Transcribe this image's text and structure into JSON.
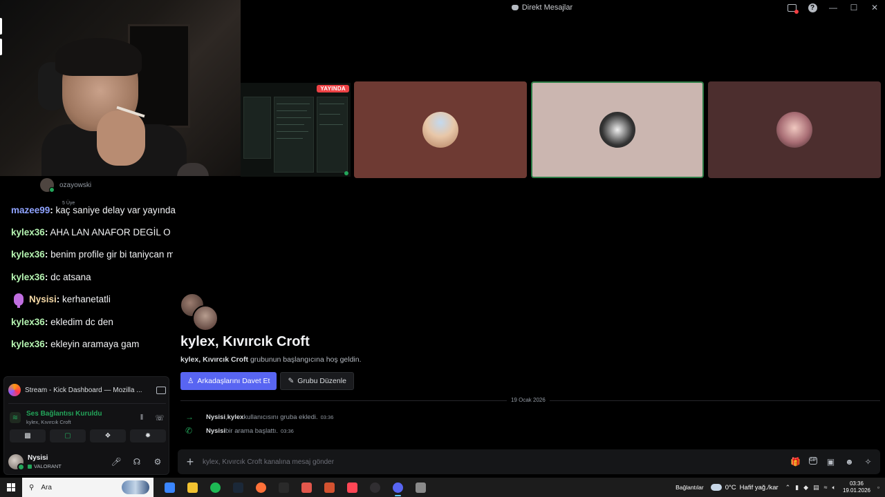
{
  "window": {
    "title": "Direkt Mesajlar",
    "controls": [
      "—",
      "☐",
      "✕"
    ]
  },
  "screenshare": {
    "badge": "YAYINDA"
  },
  "members": {
    "name": "ozayowski",
    "count": "5 Üye"
  },
  "chat_overlay": [
    {
      "user": "mazee99",
      "sep": ":",
      "msg": " kaç saniye delay var yayında",
      "color": "blue"
    },
    {
      "user": "kylex36",
      "sep": ":",
      "msg": " AHA LAN ANAFOR DEGİL O",
      "color": "green"
    },
    {
      "user": "kylex36",
      "sep": ":",
      "msg": " benim profile gir bi taniycan mi",
      "color": "green"
    },
    {
      "user": "kylex36",
      "sep": ":",
      "msg": " dc atsana",
      "color": "green"
    },
    {
      "user": "Nysisi",
      "sep": ":",
      "msg": " kerhanetatli",
      "color": "gold",
      "badge": true
    },
    {
      "user": "kylex36",
      "sep": ":",
      "msg": " ekledim dc den",
      "color": "green"
    },
    {
      "user": "kylex36",
      "sep": ":",
      "msg": " ekleyin aramaya gam",
      "color": "green"
    }
  ],
  "conversation": {
    "title": "kylex, Kıvırcık Croft",
    "intro_bold": "kylex, Kıvırcık Croft",
    "intro_rest": " grubunun başlangıcına hoş geldin.",
    "invite_button": "Arkadaşlarını Davet Et",
    "edit_button": "Grubu Düzenle",
    "date_divider": "19 Ocak 2026",
    "system_messages": [
      {
        "icon": "arrow-right-icon",
        "actor": "Nysisi",
        "sep": ", ",
        "target": "kylex",
        "text": " kullanıcısını gruba ekledi.",
        "time": "03:36"
      },
      {
        "icon": "phone-icon",
        "actor": "Nysisi",
        "sep": "",
        "target": "",
        "text": " bir arama başlattı.",
        "time": "03:36"
      }
    ],
    "composer_placeholder": "kylex, Kıvırcık Croft kanalına mesaj gönder"
  },
  "voice_panel": {
    "stream_title": "Stream - Kick Dashboard — Mozilla ...",
    "connection_status": "Ses Bağlantısı Kuruldu",
    "connection_channel": "kylex, Kıvırcık Croft",
    "user_name": "Nysisi",
    "user_activity": "VALORANT"
  },
  "taskbar": {
    "search_placeholder": "Ara",
    "network_label": "Bağlantılar",
    "weather_temp": "0°C",
    "weather_desc": "Hafif yağ./kar",
    "time": "03:36",
    "date": "19.01.2026",
    "apps": [
      {
        "name": "copilot-icon",
        "color": "#3a86ff"
      },
      {
        "name": "file-explorer-icon",
        "color": "#f2c230"
      },
      {
        "name": "spotify-icon",
        "color": "#1db954"
      },
      {
        "name": "steam-icon",
        "color": "#1b2838"
      },
      {
        "name": "firefox-icon",
        "color": "#ff7139"
      },
      {
        "name": "epic-games-icon",
        "color": "#2a2a2a"
      },
      {
        "name": "microphone-icon",
        "color": "#e2574c"
      },
      {
        "name": "bot-icon",
        "color": "#d35230"
      },
      {
        "name": "valorant-icon",
        "color": "#ff4655"
      },
      {
        "name": "obs-icon",
        "color": "#302e31"
      },
      {
        "name": "discord-icon",
        "color": "#5865f2"
      },
      {
        "name": "app-icon",
        "color": "#8a8a8a"
      }
    ]
  },
  "colors": {
    "accent": "#5865f2",
    "online": "#23a55a",
    "live": "#ed4245"
  }
}
